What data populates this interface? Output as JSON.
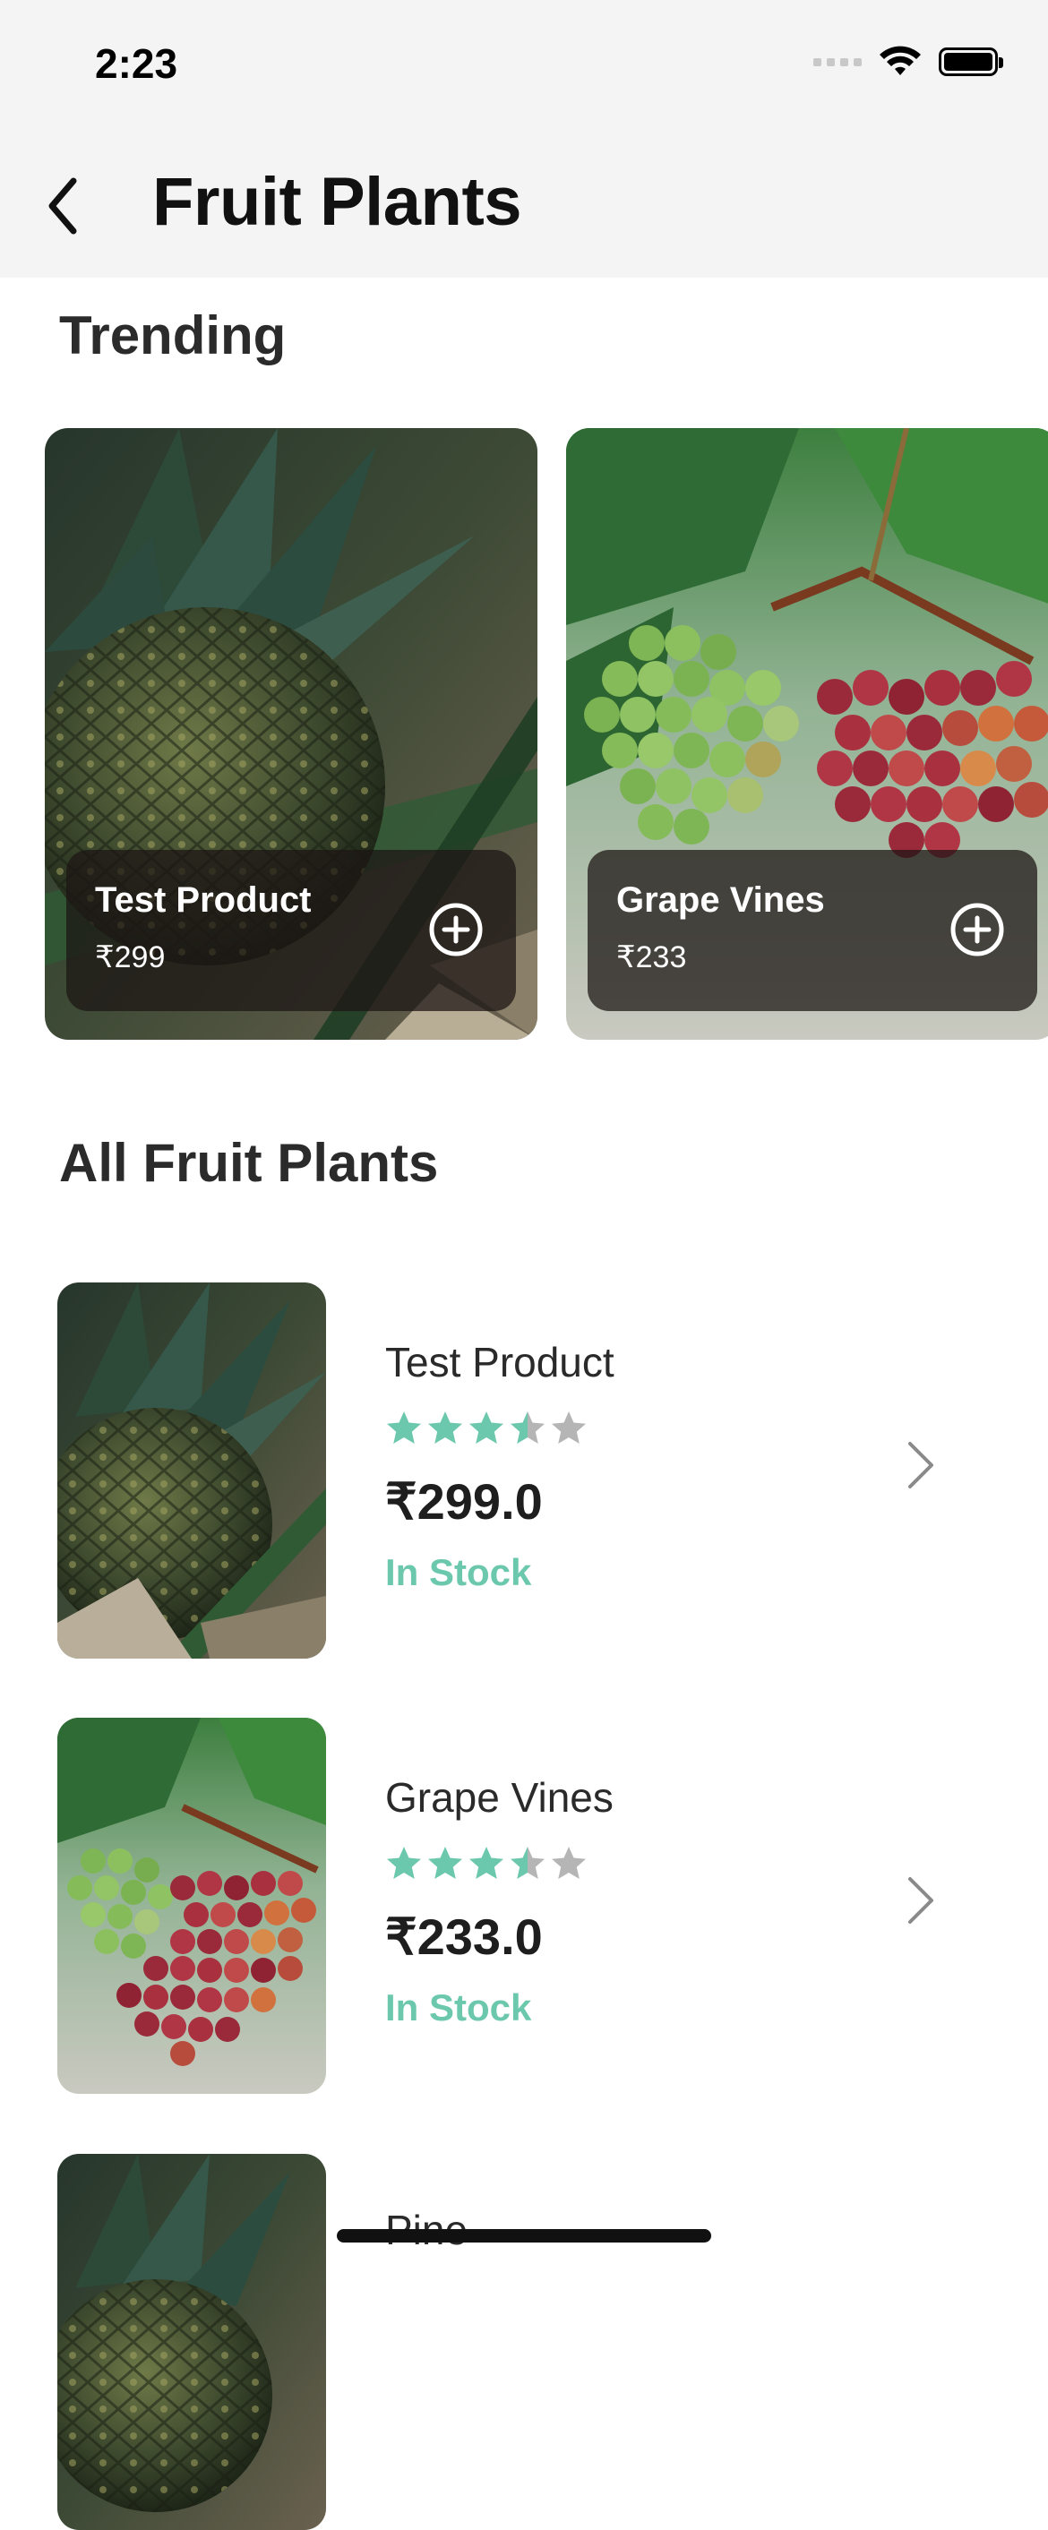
{
  "status_bar": {
    "time": "2:23"
  },
  "header": {
    "title": "Fruit Plants"
  },
  "trending": {
    "title": "Trending",
    "items": [
      {
        "name": "Test Product",
        "price": "₹299",
        "image": "pineapple"
      },
      {
        "name": "Grape Vines",
        "price": "₹233",
        "image": "grapes"
      }
    ]
  },
  "all": {
    "title": "All Fruit Plants",
    "items": [
      {
        "name": "Test Product",
        "rating": 3.5,
        "price": "₹299.0",
        "stock": "In Stock",
        "image": "pineapple"
      },
      {
        "name": "Grape Vines",
        "rating": 3.5,
        "price": "₹233.0",
        "stock": "In Stock",
        "image": "grapes"
      },
      {
        "name": "Pine",
        "image": "pineapple"
      }
    ]
  },
  "colors": {
    "accent": "#6cc8ad",
    "star_empty": "#b5b5b5",
    "header_bg": "#f4f4f4"
  },
  "icons": [
    "back-chevron-icon",
    "plus-circle-icon",
    "star-icon",
    "chevron-right-icon",
    "wifi-icon",
    "battery-icon",
    "signal-icon"
  ]
}
